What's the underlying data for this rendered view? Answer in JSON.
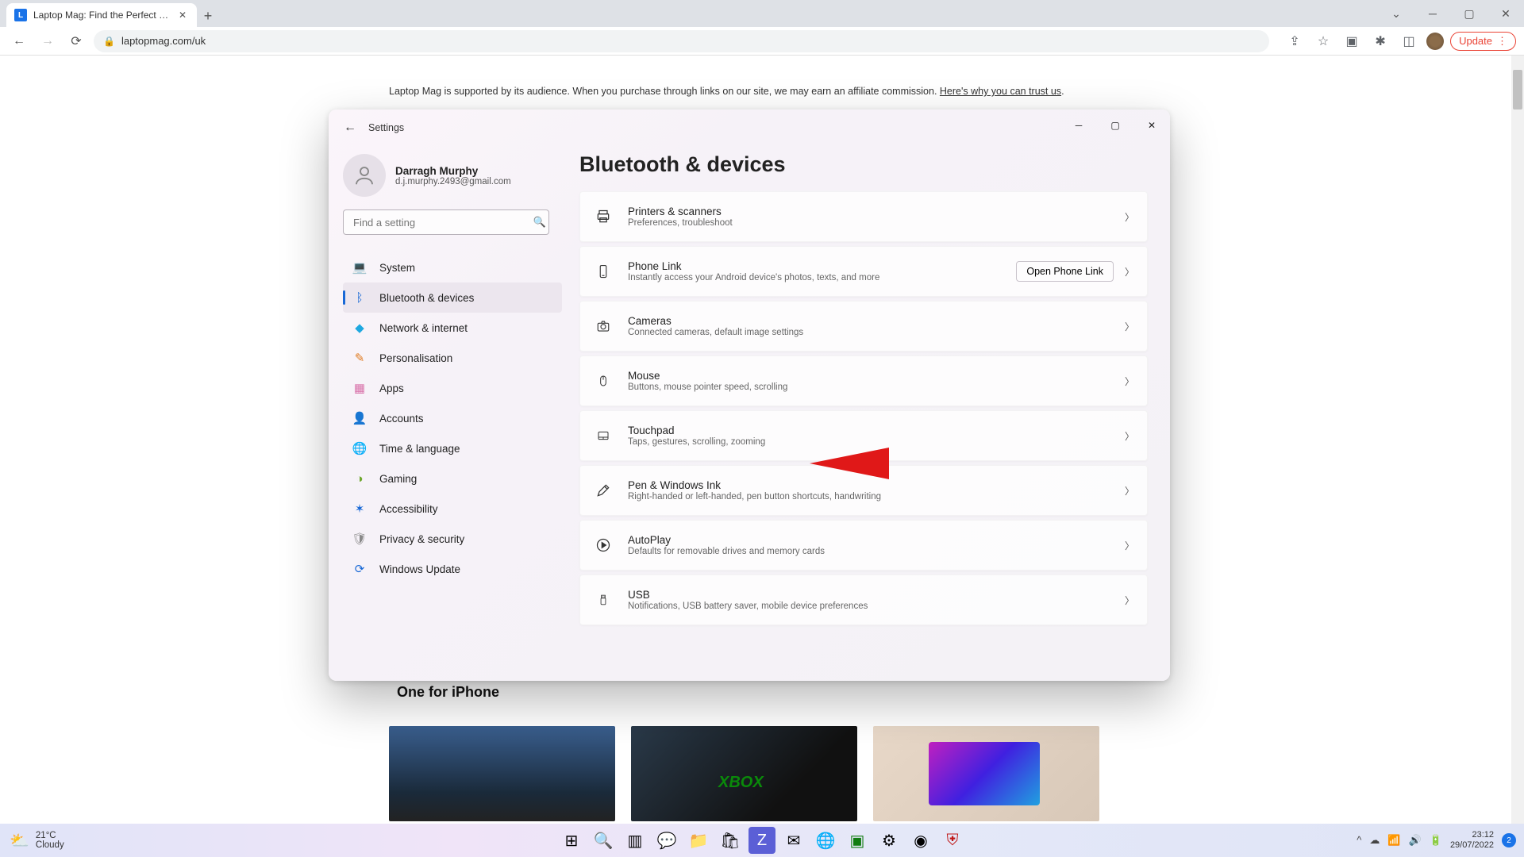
{
  "browser": {
    "tab_title": "Laptop Mag: Find the Perfect Lap",
    "tab_favicon_letter": "L",
    "url": "laptopmag.com/uk",
    "update_label": "Update"
  },
  "page": {
    "disclaimer_prefix": "Laptop Mag is supported by its audience. When you purchase through links on our site, we may earn an affiliate commission. ",
    "disclaimer_link": "Here's why you can trust us",
    "disclaimer_suffix": ".",
    "bottom_card_title": "One for iPhone"
  },
  "settings": {
    "app_label": "Settings",
    "user_name": "Darragh Murphy",
    "user_email": "d.j.murphy.2493@gmail.com",
    "search_placeholder": "Find a setting",
    "page_title": "Bluetooth & devices",
    "nav": [
      {
        "label": "System",
        "icon": "💻",
        "color": "#1e6fd8"
      },
      {
        "label": "Bluetooth & devices",
        "icon": "ᛒ",
        "color": "#1868d6",
        "active": true
      },
      {
        "label": "Network & internet",
        "icon": "◆",
        "color": "#1fa8e0"
      },
      {
        "label": "Personalisation",
        "icon": "✎",
        "color": "#e07a1f"
      },
      {
        "label": "Apps",
        "icon": "▦",
        "color": "#d86fa8"
      },
      {
        "label": "Accounts",
        "icon": "👤",
        "color": "#2fa84f"
      },
      {
        "label": "Time & language",
        "icon": "🌐",
        "color": "#4f6fd0"
      },
      {
        "label": "Gaming",
        "icon": "◑",
        "color": "#6fa82f"
      },
      {
        "label": "Accessibility",
        "icon": "✶",
        "color": "#1868d6"
      },
      {
        "label": "Privacy & security",
        "icon": "🛡",
        "color": "#888"
      },
      {
        "label": "Windows Update",
        "icon": "⟳",
        "color": "#1868d6"
      }
    ],
    "cards": [
      {
        "title": "Printers & scanners",
        "sub": "Preferences, troubleshoot",
        "icon": "printer"
      },
      {
        "title": "Phone Link",
        "sub": "Instantly access your Android device's photos, texts, and more",
        "icon": "phone",
        "action": "Open Phone Link"
      },
      {
        "title": "Cameras",
        "sub": "Connected cameras, default image settings",
        "icon": "camera"
      },
      {
        "title": "Mouse",
        "sub": "Buttons, mouse pointer speed, scrolling",
        "icon": "mouse"
      },
      {
        "title": "Touchpad",
        "sub": "Taps, gestures, scrolling, zooming",
        "icon": "touchpad"
      },
      {
        "title": "Pen & Windows Ink",
        "sub": "Right-handed or left-handed, pen button shortcuts, handwriting",
        "icon": "pen"
      },
      {
        "title": "AutoPlay",
        "sub": "Defaults for removable drives and memory cards",
        "icon": "autoplay"
      },
      {
        "title": "USB",
        "sub": "Notifications, USB battery saver, mobile device preferences",
        "icon": "usb"
      }
    ]
  },
  "taskbar": {
    "weather_temp": "21°C",
    "weather_desc": "Cloudy",
    "time": "23:12",
    "date": "29/07/2022",
    "notif_count": "2"
  }
}
